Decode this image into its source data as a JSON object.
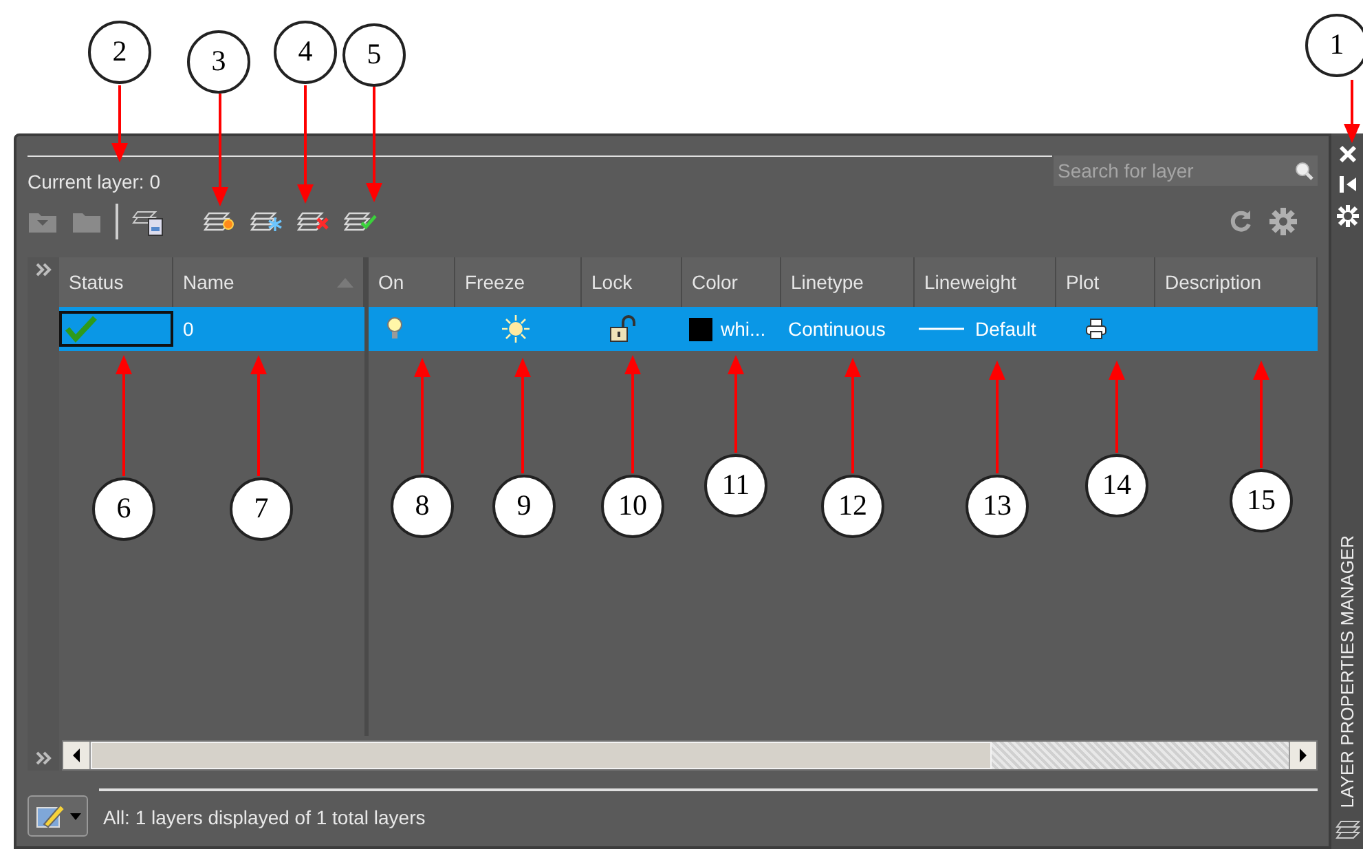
{
  "panel": {
    "current_layer": "Current layer: 0",
    "search": {
      "placeholder": "Search for layer"
    },
    "side_title": "LAYER PROPERTIES MANAGER",
    "columns": [
      "Status",
      "Name",
      "On",
      "Freeze",
      "Lock",
      "Color",
      "Linetype",
      "Lineweight",
      "Plot",
      "Description"
    ],
    "rows": [
      {
        "selected": true,
        "current": true,
        "name": "0",
        "on": true,
        "frozen": false,
        "locked": false,
        "color": "#000000",
        "color_name": "whi...",
        "linetype": "Continuous",
        "lineweight": "Default",
        "plot": true
      }
    ],
    "status_bar": "All: 1 layers displayed of 1 total layers"
  },
  "callouts": [
    {
      "label": "2"
    },
    {
      "label": "3"
    },
    {
      "label": "4"
    },
    {
      "label": "5"
    },
    {
      "label": "1"
    },
    {
      "label": "6"
    },
    {
      "label": "7"
    },
    {
      "label": "8"
    },
    {
      "label": "9"
    },
    {
      "label": "10"
    },
    {
      "label": "11"
    },
    {
      "label": "12"
    },
    {
      "label": "13"
    },
    {
      "label": "14"
    },
    {
      "label": "15"
    }
  ]
}
